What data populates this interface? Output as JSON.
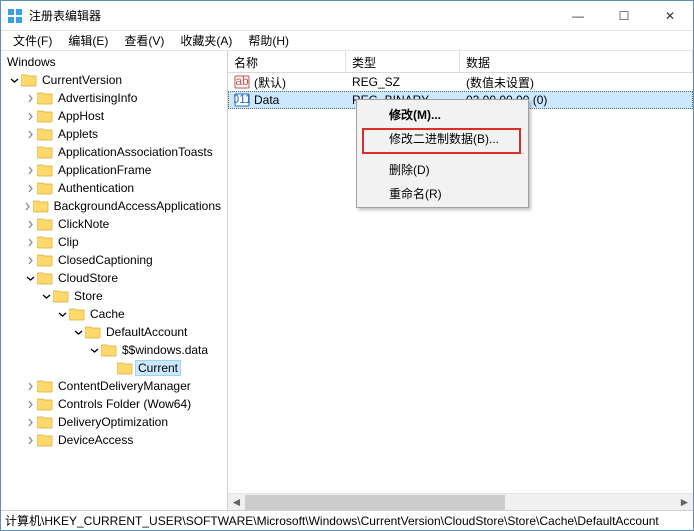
{
  "window": {
    "title": "注册表编辑器",
    "controls": {
      "min": "—",
      "max": "☐",
      "close": "✕"
    }
  },
  "menu": {
    "file": "文件(F)",
    "edit": "编辑(E)",
    "view": "查看(V)",
    "favorites": "收藏夹(A)",
    "help": "帮助(H)"
  },
  "tree": {
    "root_header": "Windows",
    "nodes": [
      {
        "label": "CurrentVersion",
        "depth": 0,
        "open": true
      },
      {
        "label": "AdvertisingInfo",
        "depth": 1,
        "open": false
      },
      {
        "label": "AppHost",
        "depth": 1,
        "open": false
      },
      {
        "label": "Applets",
        "depth": 1,
        "open": false
      },
      {
        "label": "ApplicationAssociationToasts",
        "depth": 1,
        "open": false,
        "noexp": true
      },
      {
        "label": "ApplicationFrame",
        "depth": 1,
        "open": false
      },
      {
        "label": "Authentication",
        "depth": 1,
        "open": false
      },
      {
        "label": "BackgroundAccessApplications",
        "depth": 1,
        "open": false
      },
      {
        "label": "ClickNote",
        "depth": 1,
        "open": false
      },
      {
        "label": "Clip",
        "depth": 1,
        "open": false
      },
      {
        "label": "ClosedCaptioning",
        "depth": 1,
        "open": false
      },
      {
        "label": "CloudStore",
        "depth": 1,
        "open": true
      },
      {
        "label": "Store",
        "depth": 2,
        "open": true
      },
      {
        "label": "Cache",
        "depth": 3,
        "open": true
      },
      {
        "label": "DefaultAccount",
        "depth": 4,
        "open": true
      },
      {
        "label": "$$windows.data",
        "depth": 5,
        "open": true
      },
      {
        "label": "Current",
        "depth": 6,
        "open": false,
        "selected": true,
        "noexp": true
      },
      {
        "label": "ContentDeliveryManager",
        "depth": 1,
        "open": false
      },
      {
        "label": "Controls Folder (Wow64)",
        "depth": 1,
        "open": false
      },
      {
        "label": "DeliveryOptimization",
        "depth": 1,
        "open": false
      },
      {
        "label": "DeviceAccess",
        "depth": 1,
        "open": false
      }
    ]
  },
  "list": {
    "headers": {
      "name": "名称",
      "type": "类型",
      "data": "数据"
    },
    "rows": [
      {
        "name": "(默认)",
        "type": "REG_SZ",
        "data": "(数值未设置)",
        "icon": "string"
      },
      {
        "name": "Data",
        "type": "REG_BINARY",
        "data": "02 00 00 00 (0)",
        "icon": "binary",
        "selected": true
      }
    ]
  },
  "context_menu": {
    "modify": "修改(M)...",
    "modify_binary": "修改二进制数据(B)...",
    "delete": "删除(D)",
    "rename": "重命名(R)"
  },
  "statusbar": {
    "path": "计算机\\HKEY_CURRENT_USER\\SOFTWARE\\Microsoft\\Windows\\CurrentVersion\\CloudStore\\Store\\Cache\\DefaultAccount"
  }
}
